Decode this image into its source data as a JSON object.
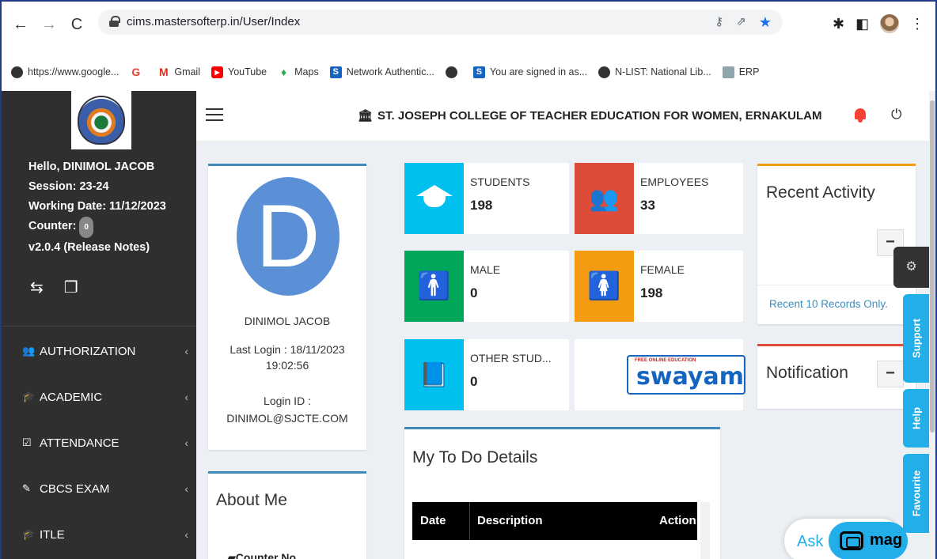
{
  "browser": {
    "url": "cims.mastersofterp.in/User/Index",
    "bookmarks": [
      {
        "label": "https://www.google...",
        "icon": "globe-icon"
      },
      {
        "label": "",
        "icon": "google-icon"
      },
      {
        "label": "Gmail",
        "icon": "gmail-icon"
      },
      {
        "label": "YouTube",
        "icon": "youtube-icon"
      },
      {
        "label": "Maps",
        "icon": "maps-icon"
      },
      {
        "label": "Network Authentic...",
        "icon": "s-icon"
      },
      {
        "label": "",
        "icon": "globe-icon"
      },
      {
        "label": "You are signed in as...",
        "icon": "s-icon"
      },
      {
        "label": "N-LIST: National Lib...",
        "icon": "globe-icon"
      },
      {
        "label": "ERP",
        "icon": "erp-icon"
      }
    ]
  },
  "sidebar": {
    "hello": "Hello, DINIMOL JACOB",
    "session": "Session: 23-24",
    "working_date": "Working Date: 11/12/2023",
    "counter_label": "Counter:",
    "counter_value": "0",
    "version": "v2.0.4 (Release Notes)",
    "menu": [
      {
        "label": "AUTHORIZATION",
        "icon": "users-icon"
      },
      {
        "label": "ACADEMIC",
        "icon": "graduation-cap-icon"
      },
      {
        "label": "ATTENDANCE",
        "icon": "checkbox-icon"
      },
      {
        "label": "CBCS EXAM",
        "icon": "edit-icon"
      },
      {
        "label": "ITLE",
        "icon": "graduation-cap-icon"
      }
    ]
  },
  "header": {
    "college": "ST. JOSEPH COLLEGE OF TEACHER EDUCATION FOR WOMEN, ERNAKULAM"
  },
  "profile": {
    "initial": "D",
    "name": "DINIMOL JACOB",
    "last_login_label": "Last Login : 18/11/2023",
    "last_login_time": "19:02:56",
    "login_id_label": "Login ID :",
    "login_id": "DINIMOL@SJCTE.COM"
  },
  "about": {
    "title": "About Me",
    "counter_no": "Counter No"
  },
  "stats": [
    {
      "label": "STUDENTS",
      "value": "198",
      "color": "#00c0ef"
    },
    {
      "label": "EMPLOYEES",
      "value": "33",
      "color": "#dd4b39"
    },
    {
      "label": "MALE",
      "value": "0",
      "color": "#00a65a"
    },
    {
      "label": "FEMALE",
      "value": "198",
      "color": "#f39c12"
    },
    {
      "label": "OTHER STUD...",
      "value": "0",
      "color": "#00c0ef"
    }
  ],
  "swayam": {
    "tagline": "FREE ONLINE EDUCATION",
    "name": "swayam"
  },
  "todo": {
    "title": "My To Do Details",
    "columns": [
      "Date",
      "Description",
      "Action"
    ]
  },
  "recent": {
    "title": "Recent Activity",
    "footer": "Recent 10 Records Only."
  },
  "notification": {
    "title": "Notification"
  },
  "side_tabs": {
    "support": "Support",
    "help": "Help",
    "favourite": "Favourite"
  },
  "chatbot": {
    "ask": "Ask",
    "brand": "mag"
  }
}
